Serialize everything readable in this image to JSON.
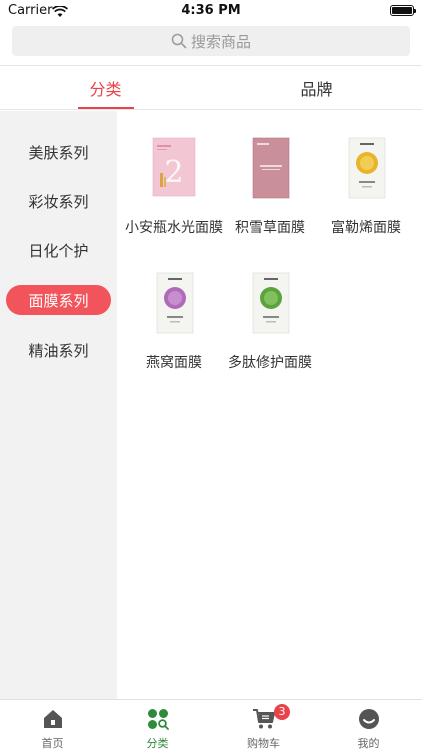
{
  "status_bar": {
    "carrier": "Carrier",
    "time": "4:36 PM"
  },
  "search": {
    "placeholder": "搜索商品"
  },
  "tabs": [
    {
      "label": "分类",
      "active": true
    },
    {
      "label": "品牌",
      "active": false
    }
  ],
  "sidebar": {
    "items": [
      {
        "label": "美肤系列",
        "active": false
      },
      {
        "label": "彩妆系列",
        "active": false
      },
      {
        "label": "日化个护",
        "active": false
      },
      {
        "label": "面膜系列",
        "active": true
      },
      {
        "label": "精油系列",
        "active": false
      }
    ]
  },
  "products": [
    {
      "name": "小安瓶水光面膜",
      "icon": "pink-ampoule-mask"
    },
    {
      "name": "积雪草面膜",
      "icon": "rose-pink-mask"
    },
    {
      "name": "富勒烯面膜",
      "icon": "gold-mask"
    },
    {
      "name": "燕窝面膜",
      "icon": "purple-mask"
    },
    {
      "name": "多肽修护面膜",
      "icon": "green-mask"
    }
  ],
  "tabbar": {
    "items": [
      {
        "label": "首页",
        "icon": "home-icon",
        "active": false
      },
      {
        "label": "分类",
        "icon": "category-icon",
        "active": true
      },
      {
        "label": "购物车",
        "icon": "cart-icon",
        "active": false
      },
      {
        "label": "我的",
        "icon": "profile-icon",
        "active": false
      }
    ],
    "cart_badge": "3"
  },
  "colors": {
    "accent": "#e8424a",
    "active_tab_green": "#2e8b3a"
  }
}
